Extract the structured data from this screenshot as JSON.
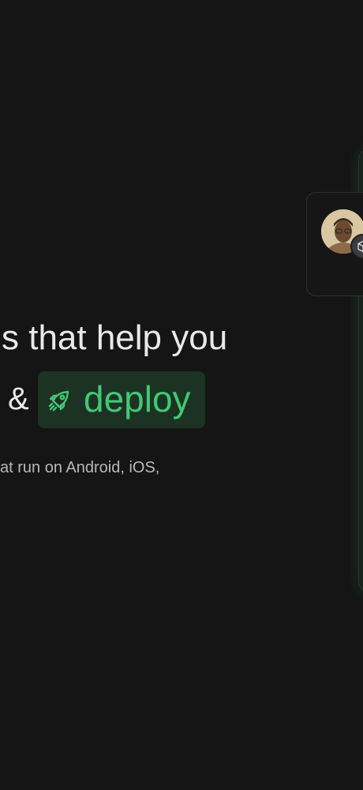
{
  "hero": {
    "headline_line1": "s that help you",
    "headline_amp": "&",
    "deploy_label": "deploy",
    "subtext": "at run on Android, iOS,"
  },
  "colors": {
    "background": "#151516",
    "accent_green": "#42c874",
    "pill_bg": "#1c3324",
    "text": "#e9e9ea",
    "muted_text": "#b8b9bc"
  },
  "icons": {
    "rocket": "rocket-icon",
    "cube": "cube-icon"
  }
}
